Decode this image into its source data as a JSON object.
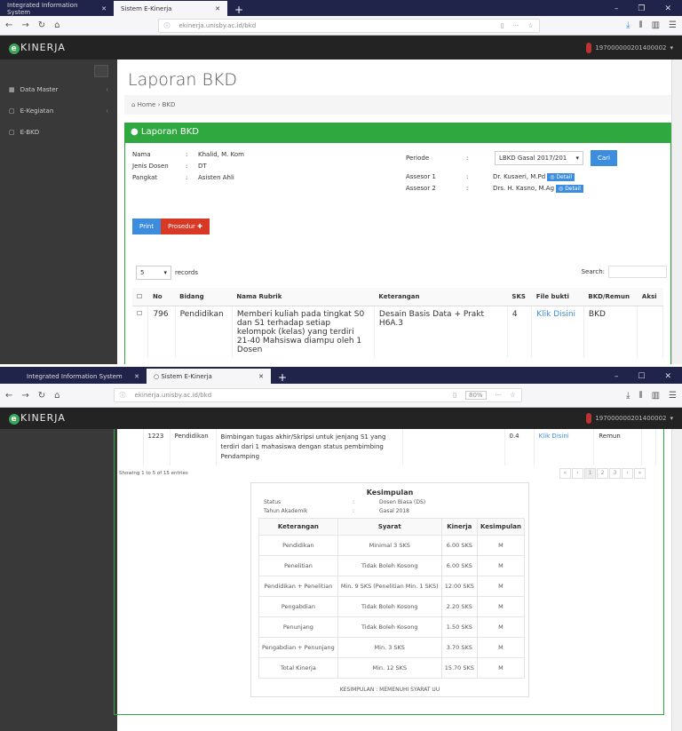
{
  "browser_top": {
    "tabs": [
      "Integrated Information System",
      "Sistem E-Kinerja"
    ],
    "url": "ekinerja.unisby.ac.id/bkd",
    "new_tab": "+",
    "win": [
      "–",
      "❐",
      "✕"
    ]
  },
  "browser_bottom": {
    "tabs": [
      "Integrated Information System",
      "Sistem E-Kinerja"
    ],
    "url": "ekinerja.unisby.ac.id/bkd",
    "zoom": "80%",
    "new_tab": "+",
    "win": [
      "–",
      "☐",
      "✕"
    ]
  },
  "app": {
    "logo_letter": "e",
    "logo_text": "KINERJA",
    "user": "197000000201400002"
  },
  "sidebar": {
    "items": [
      {
        "label": "Data Master",
        "icon": "grid-icon"
      },
      {
        "label": "E-Kegiatan",
        "icon": "file-icon"
      },
      {
        "label": "E-BKD",
        "icon": "file-icon"
      }
    ]
  },
  "page": {
    "title": "Laporan BKD",
    "breadcrumb": [
      "Home",
      "BKD"
    ],
    "box_title": "Laporan BKD"
  },
  "profile": {
    "nama_label": "Nama",
    "nama": "Khalid, M. Kom",
    "jenis_label": "Jenis Dosen",
    "jenis": "DT",
    "pangkat_label": "Pangkat",
    "pangkat": "Asisten Ahli",
    "periode_label": "Periode",
    "periode": "LBKD Gasal 2017/201",
    "cari": "Cari",
    "asesor1_label": "Assesor 1",
    "asesor1": "Dr. Kusaeri, M.Pd",
    "asesor2_label": "Assesor 2",
    "asesor2": "Drs. H. Kasno, M.Ag",
    "detail": "Detail",
    "sep": ":"
  },
  "actions": {
    "print": "Print",
    "prosedur": "Prosedur"
  },
  "table": {
    "length": "5",
    "records": "records",
    "search_label": "Search:",
    "columns": [
      "No",
      "Bidang",
      "Nama Rubrik",
      "Keterangan",
      "SKS",
      "File bukti",
      "BKD/Remun",
      "Aksi"
    ],
    "rows": [
      {
        "no": "796",
        "bidang": "Pendidikan",
        "rubrik": "Memberi kuliah pada tingkat S0 dan S1 terhadap setiap kelompok (kelas) yang terdiri 21-40 Mahsiswa diampu oleh 1 Dosen",
        "keterangan": "Desain Basis Data + Prakt H6A.3",
        "sks": "4",
        "file": "Klik Disini",
        "jenis": "BKD"
      },
      {
        "no": "1223",
        "bidang": "Pendidikan",
        "rubrik": "Bimbingan tugas akhir/Skripsi untuk jenjang S1 yang terdiri dari 1 mahasiswa dengan status pembimbing Pendamping",
        "keterangan": "",
        "sks": "0.4",
        "file": "Klik Disini",
        "jenis": "Remun"
      }
    ],
    "info": "Showing 1 to 5 of 15 entries",
    "pages": [
      "«",
      "‹",
      "1",
      "2",
      "3",
      "›",
      "»"
    ]
  },
  "kesimpulan": {
    "title": "Kesimpulan",
    "status_label": "Status",
    "status": "Dosen Biasa (DS)",
    "tahun_label": "Tahun Akademik",
    "tahun": "Gasal 2018",
    "columns": [
      "Keterangan",
      "Syarat",
      "Kinerja",
      "Kesimpulan"
    ],
    "rows": [
      [
        "Pendidikan",
        "Minimal 3 SKS",
        "6.00 SKS",
        "M"
      ],
      [
        "Penelitian",
        "Tidak Boleh Kosong",
        "6.00 SKS",
        "M"
      ],
      [
        "Pendidikan + Penelitian",
        "Min. 9 SKS (Penelitian Min. 1 SKS)",
        "12.00 SKS",
        "M"
      ],
      [
        "Pengabdian",
        "Tidak Boleh Kosong",
        "2.20 SKS",
        "M"
      ],
      [
        "Penunjang",
        "Tidak Boleh Kosong",
        "1.50 SKS",
        "M"
      ],
      [
        "Pengabdian + Penunjang",
        "Min. 3 SKS",
        "3.70 SKS",
        "M"
      ],
      [
        "Total Kinerja",
        "Min. 12 SKS",
        "15.70 SKS",
        "M"
      ]
    ],
    "footer": "KESIMPULAN : MEMENUHI SYARAT UU"
  },
  "colors": {
    "green": "#2ea83f",
    "blue": "#3c8dde",
    "red": "#d73925",
    "header": "#232323",
    "sidebar": "#393939"
  }
}
